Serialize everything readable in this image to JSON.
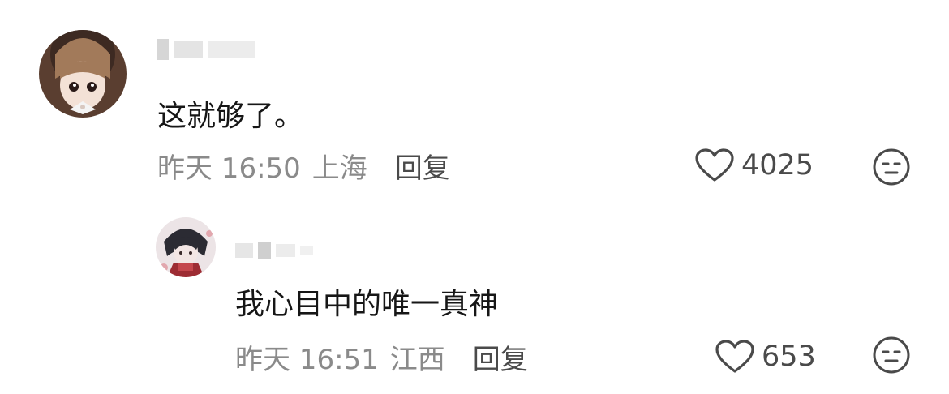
{
  "comments": [
    {
      "text": "这就够了。",
      "time": "昨天 16:50",
      "location": "上海",
      "reply_label": "回复",
      "likes": "4025"
    },
    {
      "text": "我心目中的唯一真神",
      "time": "昨天 16:51",
      "location": "江西",
      "reply_label": "回复",
      "likes": "653"
    }
  ],
  "icons": {
    "like": "heart-outline-icon",
    "dislike": "neutral-face-icon"
  },
  "colors": {
    "text": "#161616",
    "meta": "#8a8a8a",
    "action": "#4a4a4a"
  }
}
